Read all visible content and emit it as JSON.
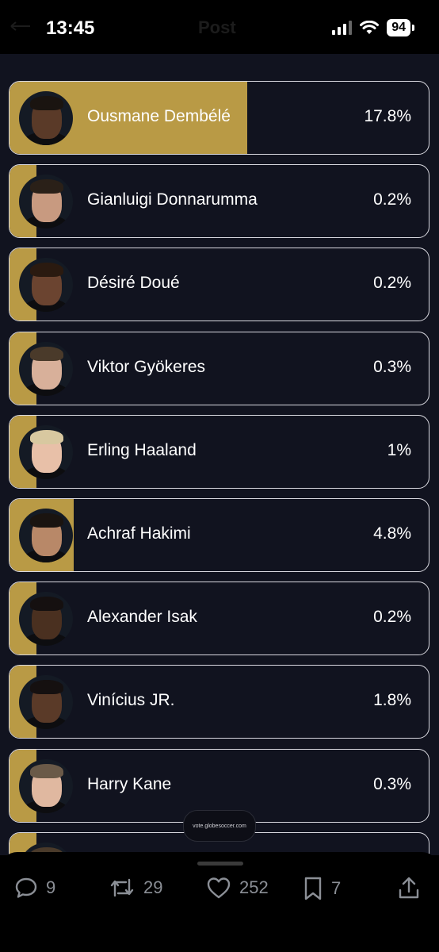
{
  "status_bar": {
    "time": "13:45",
    "title": "Post",
    "battery": "94"
  },
  "players": [
    {
      "name": "Ousmane Dembélé",
      "percent": "17.8%",
      "share": 0.178,
      "skin": "#5a3a28",
      "hair": "#1a1410"
    },
    {
      "name": "Gianluigi Donnarumma",
      "percent": "0.2%",
      "share": 0.002,
      "skin": "#c89a80",
      "hair": "#2a2018"
    },
    {
      "name": "Désiré Doué",
      "percent": "0.2%",
      "share": 0.002,
      "skin": "#6b4430",
      "hair": "#2a1a10"
    },
    {
      "name": "Viktor Gyökeres",
      "percent": "0.3%",
      "share": 0.003,
      "skin": "#d8b09a",
      "hair": "#4a3a2a"
    },
    {
      "name": "Erling Haaland",
      "percent": "1%",
      "share": 0.01,
      "skin": "#e8c0a8",
      "hair": "#d8c8a0"
    },
    {
      "name": "Achraf Hakimi",
      "percent": "4.8%",
      "share": 0.048,
      "skin": "#b88868",
      "hair": "#1a1410"
    },
    {
      "name": "Alexander Isak",
      "percent": "0.2%",
      "share": 0.002,
      "skin": "#4a3020",
      "hair": "#151010"
    },
    {
      "name": "Vinícius JR.",
      "percent": "1.8%",
      "share": 0.018,
      "skin": "#5a3a28",
      "hair": "#151010"
    },
    {
      "name": "Harry Kane",
      "percent": "0.3%",
      "share": 0.003,
      "skin": "#e0b8a0",
      "hair": "#6a5a48"
    },
    {
      "name": "",
      "percent": "",
      "share": 0.015,
      "skin": "#d8b09a",
      "hair": "#4a3a2a"
    }
  ],
  "watermark": "vote.globesoccer.com",
  "actions": {
    "replies": "9",
    "reposts": "29",
    "likes": "252",
    "bookmarks": "7"
  },
  "colors": {
    "accent": "#b99a45",
    "card_background": "#11131f",
    "icon_gray": "#8b8f96"
  }
}
